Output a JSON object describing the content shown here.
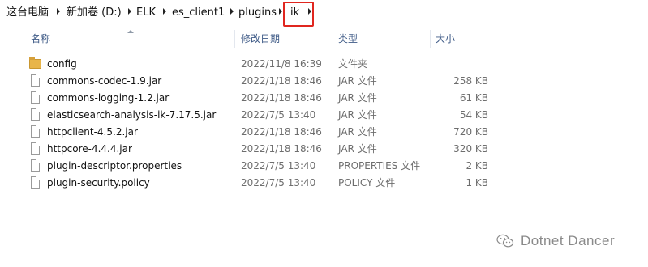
{
  "breadcrumb": [
    "这台电脑",
    "新加卷 (D:)",
    "ELK",
    "es_client1",
    "plugins",
    "ik"
  ],
  "columns": {
    "name": "名称",
    "date": "修改日期",
    "type": "类型",
    "size": "大小"
  },
  "files": [
    {
      "icon": "folder-icon",
      "name": "config",
      "date": "2022/11/8 16:39",
      "type": "文件夹",
      "size": ""
    },
    {
      "icon": "file-icon",
      "name": "commons-codec-1.9.jar",
      "date": "2022/1/18 18:46",
      "type": "JAR 文件",
      "size": "258 KB"
    },
    {
      "icon": "file-icon",
      "name": "commons-logging-1.2.jar",
      "date": "2022/1/18 18:46",
      "type": "JAR 文件",
      "size": "61 KB"
    },
    {
      "icon": "file-icon",
      "name": "elasticsearch-analysis-ik-7.17.5.jar",
      "date": "2022/7/5 13:40",
      "type": "JAR 文件",
      "size": "54 KB"
    },
    {
      "icon": "file-icon",
      "name": "httpclient-4.5.2.jar",
      "date": "2022/1/18 18:46",
      "type": "JAR 文件",
      "size": "720 KB"
    },
    {
      "icon": "file-icon",
      "name": "httpcore-4.4.4.jar",
      "date": "2022/1/18 18:46",
      "type": "JAR 文件",
      "size": "320 KB"
    },
    {
      "icon": "file-icon",
      "name": "plugin-descriptor.properties",
      "date": "2022/7/5 13:40",
      "type": "PROPERTIES 文件",
      "size": "2 KB"
    },
    {
      "icon": "file-icon",
      "name": "plugin-security.policy",
      "date": "2022/7/5 13:40",
      "type": "POLICY 文件",
      "size": "1 KB"
    }
  ],
  "watermark": {
    "icon": "wechat-icon",
    "text": "Dotnet Dancer"
  },
  "colors": {
    "highlight": "#e0261f",
    "header_text": "#3f5b87",
    "folder": "#e8b54a"
  }
}
